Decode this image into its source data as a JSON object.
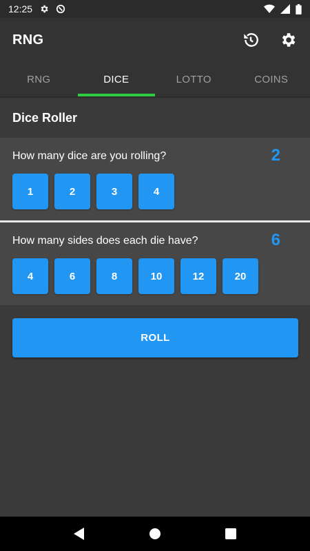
{
  "status_bar": {
    "time": "12:25",
    "icons": [
      "gear-icon",
      "vpn-icon",
      "wifi-icon",
      "signal-icon",
      "battery-icon"
    ]
  },
  "app_bar": {
    "title": "RNG",
    "actions": [
      "history-icon",
      "settings-icon"
    ]
  },
  "tabs": [
    {
      "label": "RNG",
      "active": false
    },
    {
      "label": "DICE",
      "active": true
    },
    {
      "label": "LOTTO",
      "active": false
    },
    {
      "label": "COINS",
      "active": false
    }
  ],
  "section_title": "Dice Roller",
  "dice_count": {
    "question": "How many dice are you rolling?",
    "selected": "2",
    "options": [
      "1",
      "2",
      "3",
      "4"
    ]
  },
  "dice_sides": {
    "question": "How many sides does each die have?",
    "selected": "6",
    "options": [
      "4",
      "6",
      "8",
      "10",
      "12",
      "20"
    ]
  },
  "roll_label": "ROLL",
  "nav": [
    "back-icon",
    "home-icon",
    "recents-icon"
  ],
  "colors": {
    "accent": "#2196f3",
    "tab_indicator": "#2ecc40",
    "background": "#3a3a3a",
    "card": "#474747",
    "app_bar": "#333333"
  }
}
